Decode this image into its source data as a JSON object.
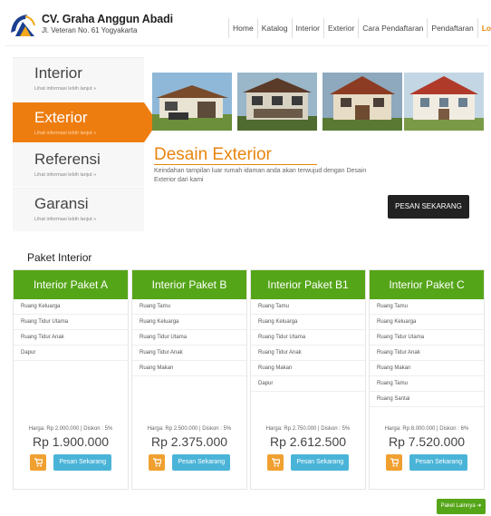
{
  "brand": {
    "name": "CV. Graha Anggun Abadi",
    "address": "Jl. Veteran No. 61 Yogyakarta"
  },
  "nav": [
    "Home",
    "Katalog",
    "Interior",
    "Exterior",
    "Cara Pendaftaran",
    "Pendaftaran",
    "Login"
  ],
  "sidebar": [
    {
      "title": "Interior",
      "sub": "Lihat informasi lebih lanjut »"
    },
    {
      "title": "Exterior",
      "sub": "Lihat informasi lebih lanjut »"
    },
    {
      "title": "Referensi",
      "sub": "Lihat informasi lebih lanjut »"
    },
    {
      "title": "Garansi",
      "sub": "Lihat informasi lebih lanjut »"
    }
  ],
  "feature": {
    "title": "Desain Exterior",
    "text": "Keindahan tampilan luar rumah idaman anda akan terwujud dengan Desain Exterior dari kami",
    "order_label": "PESAN SEKARANG"
  },
  "section_title": "Paket Interior",
  "packages": [
    {
      "title": "Interior Paket A",
      "items": [
        "Ruang Keluarga",
        "Ruang Tidur Utama",
        "Ruang Tidur Anak",
        "Dapur"
      ],
      "price_note": "Harga: Rp 2.000.000 | Diskon : 5%",
      "price": "Rp 1.900.000"
    },
    {
      "title": "Interior Paket B",
      "items": [
        "Ruang Tamu",
        "Ruang Keluarga",
        "Ruang Tidur Utama",
        "Ruang Tidur Anak",
        "Ruang Makan"
      ],
      "price_note": "Harga: Rp 2.500.000 | Diskon : 5%",
      "price": "Rp 2.375.000"
    },
    {
      "title": "Interior Paket B1",
      "items": [
        "Ruang Tamu",
        "Ruang Keluarga",
        "Ruang Tidur Utama",
        "Ruang Tidur Anak",
        "Ruang Makan",
        "Dapur"
      ],
      "price_note": "Harga: Rp 2.750.000 | Diskon : 5%",
      "price": "Rp 2.612.500"
    },
    {
      "title": "Interior Paket C",
      "items": [
        "Ruang Tamu",
        "Ruang Keluarga",
        "Ruang Tidur Utama",
        "Ruang Tidur Anak",
        "Ruang Makan",
        "Ruang Tamu",
        "Ruang Santai"
      ],
      "price_note": "Harga: Rp 8.000.000 | Diskon : 6%",
      "price": "Rp 7.520.000"
    }
  ],
  "order_label": "Pesan Sekarang",
  "next_label": "Paket Lainnya",
  "colors": {
    "accent": "#ee7d10",
    "green": "#55a518",
    "blue": "#4ab4d8"
  }
}
